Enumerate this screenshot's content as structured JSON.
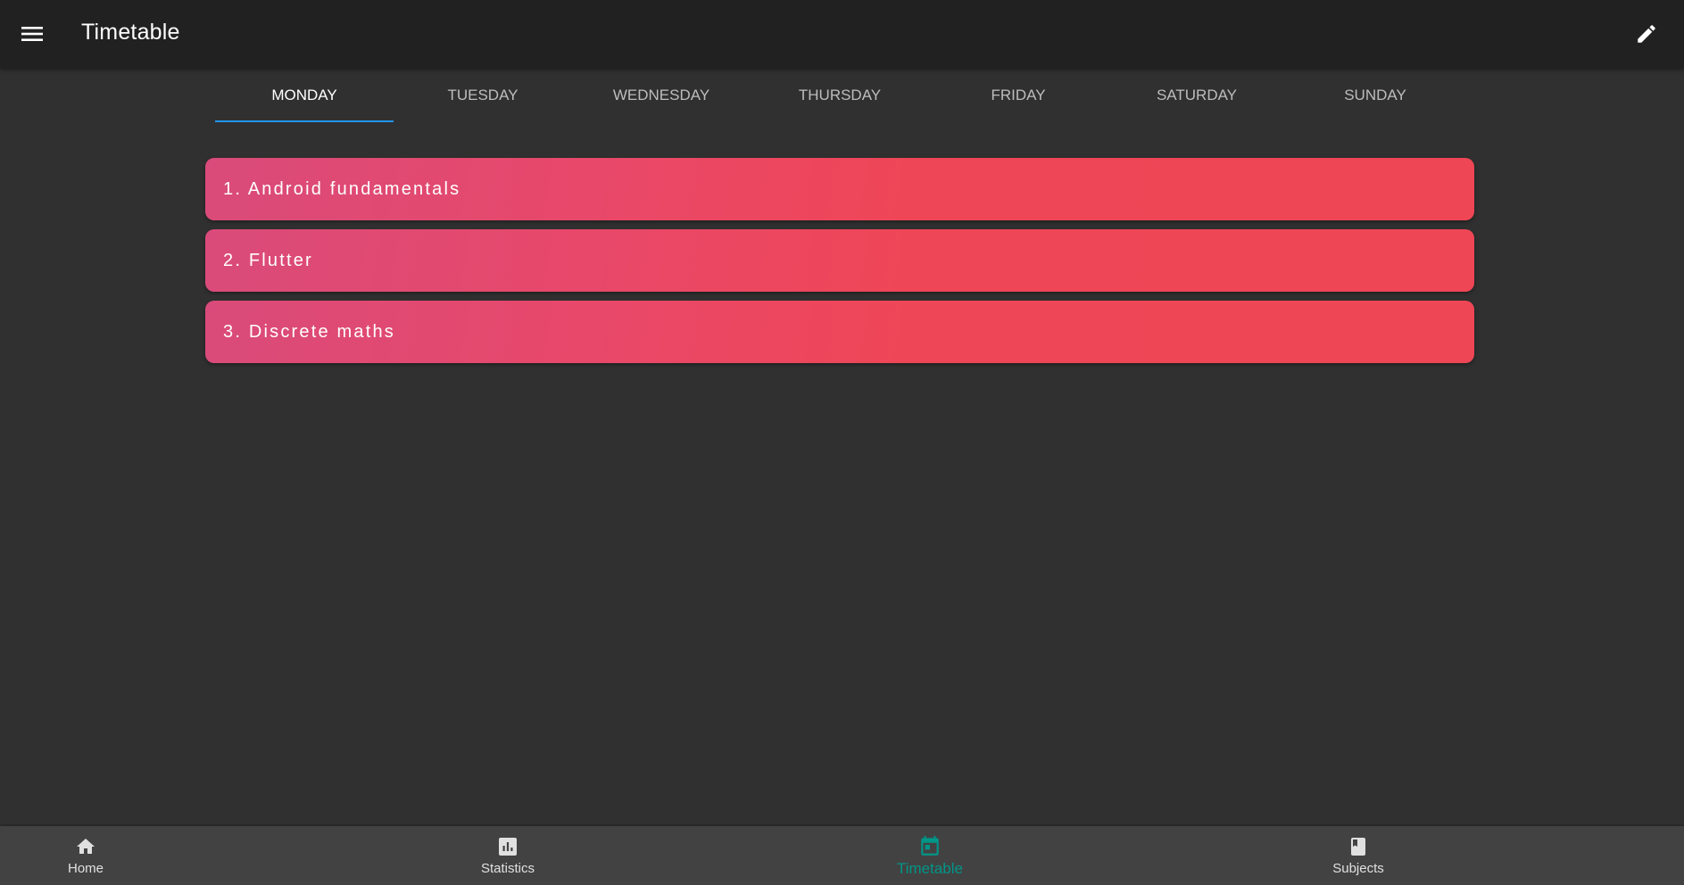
{
  "appbar": {
    "title": "Timetable",
    "menu_icon": "menu-icon",
    "edit_icon": "edit-pencil-icon"
  },
  "tabs": [
    {
      "label": "MONDAY",
      "active": true
    },
    {
      "label": "TUESDAY",
      "active": false
    },
    {
      "label": "WEDNESDAY",
      "active": false
    },
    {
      "label": "THURSDAY",
      "active": false
    },
    {
      "label": "FRIDAY",
      "active": false
    },
    {
      "label": "SATURDAY",
      "active": false
    },
    {
      "label": "SUNDAY",
      "active": false
    }
  ],
  "lessons": [
    {
      "label": "1. Android fundamentals"
    },
    {
      "label": "2. Flutter"
    },
    {
      "label": "3. Discrete maths"
    }
  ],
  "bottom_nav": [
    {
      "label": "Home",
      "icon": "home-icon",
      "active": false
    },
    {
      "label": "Statistics",
      "icon": "bar-chart-icon",
      "active": false
    },
    {
      "label": "Timetable",
      "icon": "calendar-icon",
      "active": true
    },
    {
      "label": "Subjects",
      "icon": "book-icon",
      "active": false
    }
  ],
  "colors": {
    "appbar_bg": "#212121",
    "page_bg": "#303030",
    "tab_indicator": "#2196f3",
    "lesson_gradient_start": "#d94b7a",
    "lesson_gradient_end": "#ef4656",
    "nav_active": "#009688",
    "nav_bg": "#424242"
  }
}
